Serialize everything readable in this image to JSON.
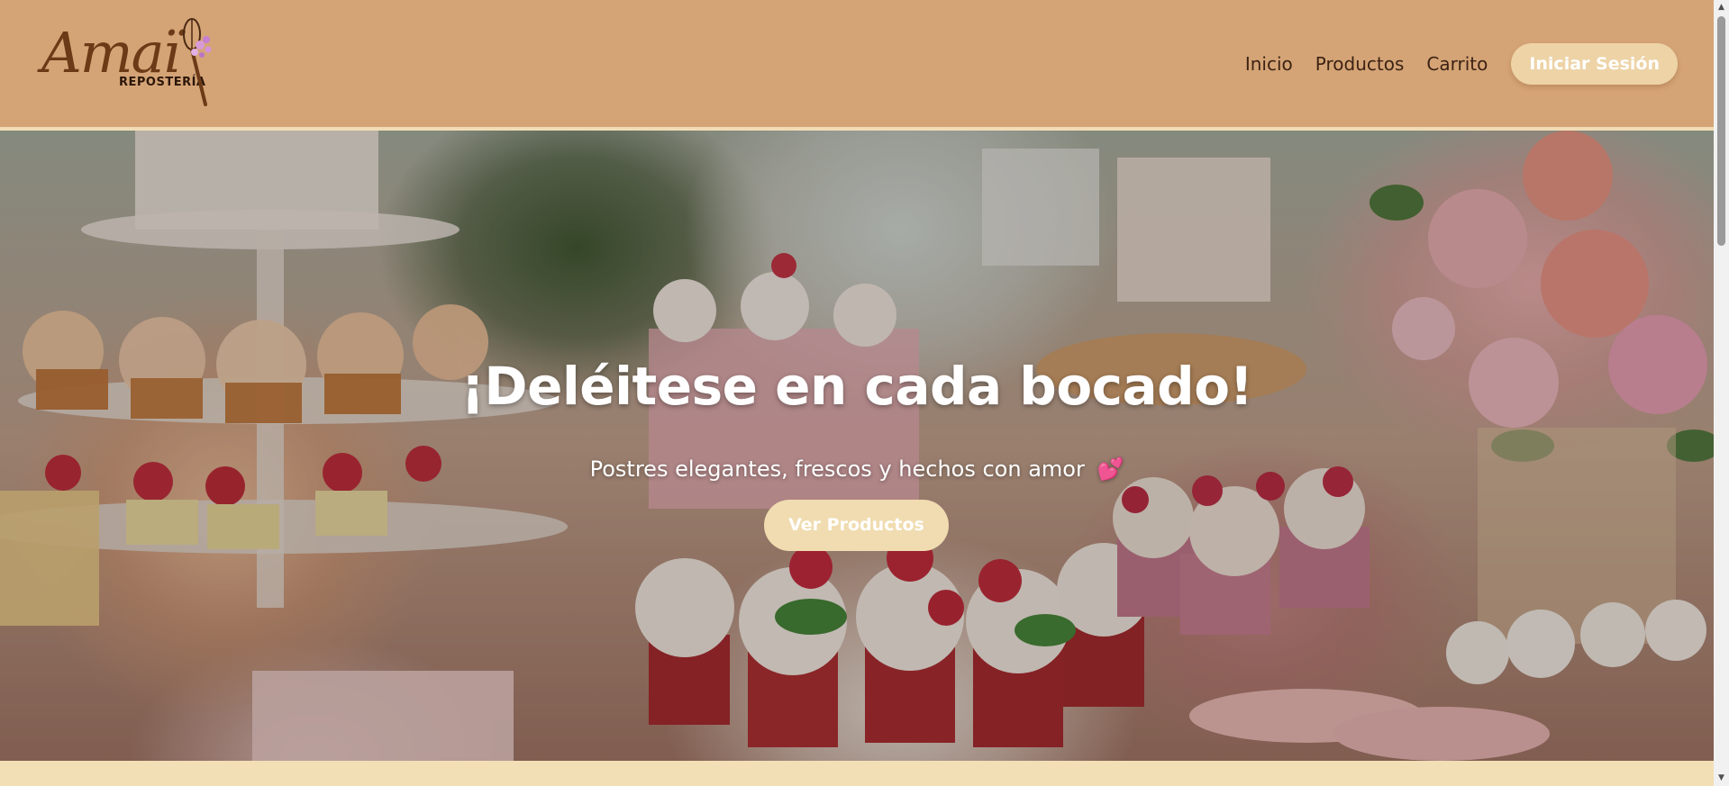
{
  "logo": {
    "script_text": "Amaï",
    "subtitle": "REPOSTERÍA",
    "icon": "whisk-flower-icon"
  },
  "nav": {
    "items": [
      {
        "label": "Inicio"
      },
      {
        "label": "Productos"
      },
      {
        "label": "Carrito"
      }
    ],
    "login_label": "Iniciar Sesión"
  },
  "hero": {
    "title": "¡Deléitese en cada bocado!",
    "subtitle": "Postres elegantes, frescos y hechos con amor",
    "subtitle_emoji": "💕",
    "button_label": "Ver Productos"
  },
  "colors": {
    "header_bg": "#d5a476",
    "accent_button": "#f0dcb0",
    "nav_text": "#3c2313",
    "page_bg": "#f3dfb6"
  }
}
